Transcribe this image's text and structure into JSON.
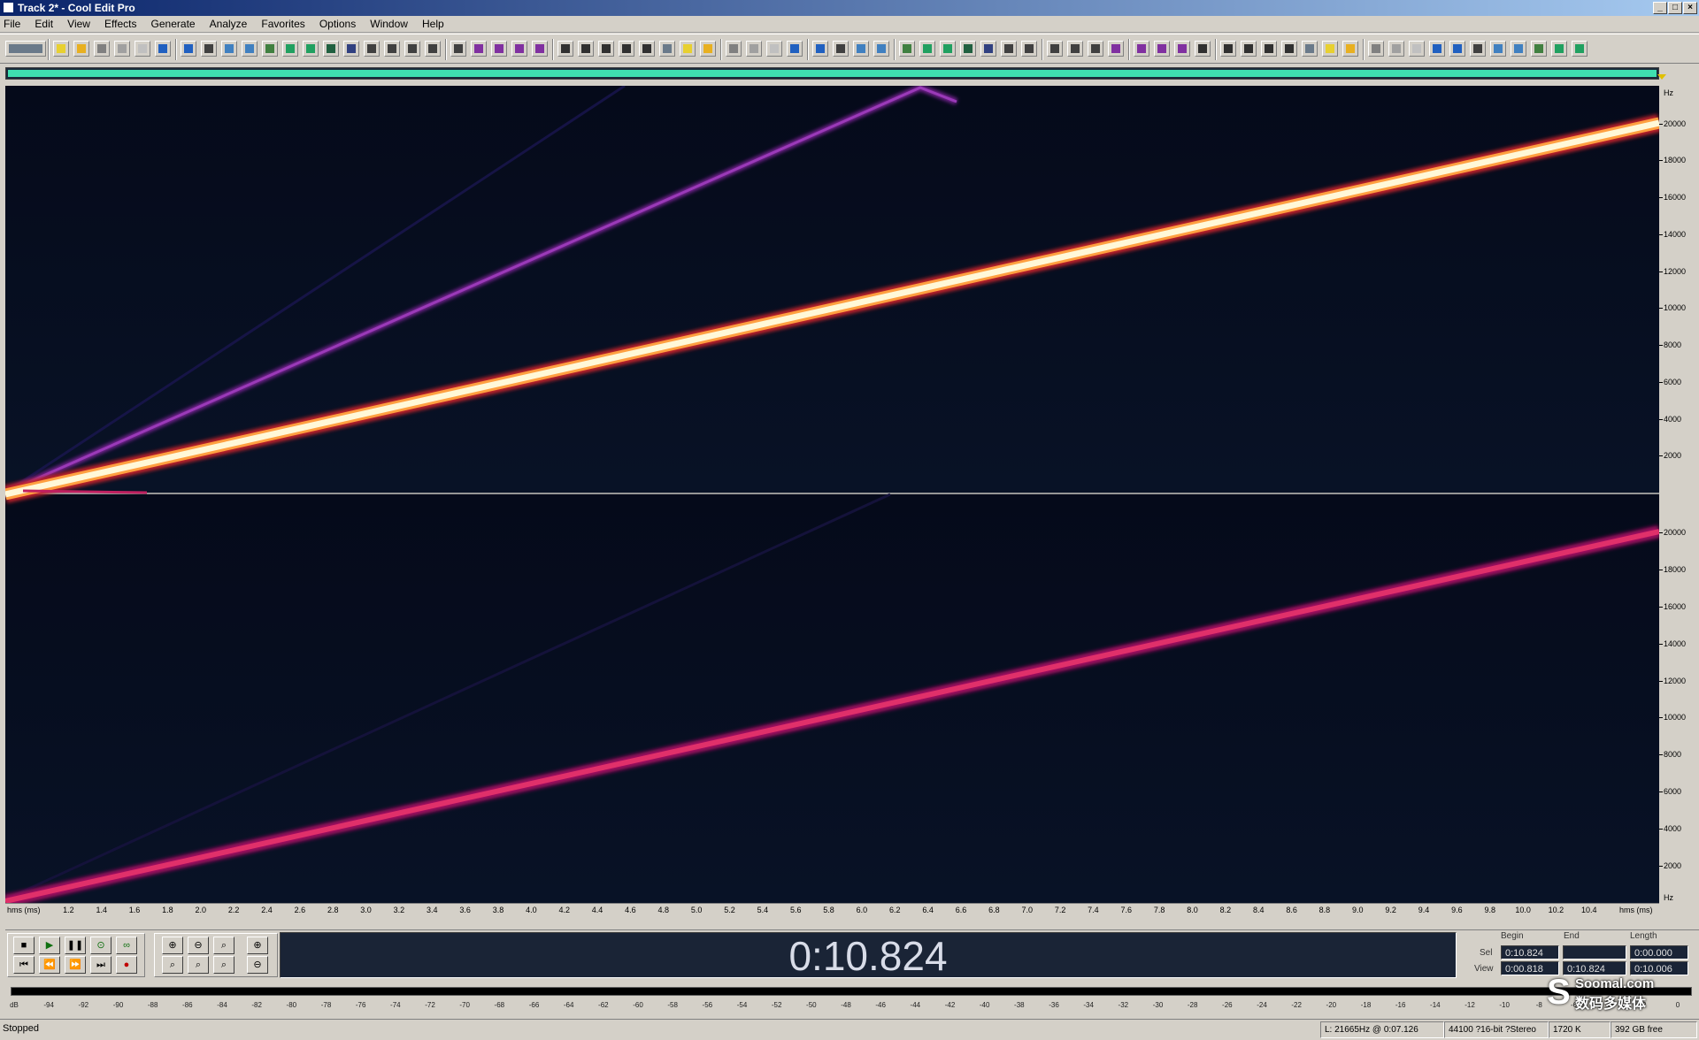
{
  "window": {
    "title": "Track 2* - Cool Edit Pro",
    "controls": [
      "_",
      "□",
      "×"
    ]
  },
  "menu": [
    "File",
    "Edit",
    "View",
    "Effects",
    "Generate",
    "Analyze",
    "Favorites",
    "Options",
    "Window",
    "Help"
  ],
  "spectrogram": {
    "view": "spectral-view",
    "channels": [
      "left",
      "right"
    ],
    "freq_unit": "Hz",
    "freq_labels": [
      "20000",
      "18000",
      "16000",
      "14000",
      "12000",
      "10000",
      "8000",
      "6000",
      "4000",
      "2000"
    ],
    "time_unit_left": "hms (ms)",
    "time_unit_right": "hms (ms)",
    "time_labels": [
      "1.2",
      "1.4",
      "1.6",
      "1.8",
      "2.0",
      "2.2",
      "2.4",
      "2.6",
      "2.8",
      "3.0",
      "3.2",
      "3.4",
      "3.6",
      "3.8",
      "4.0",
      "4.2",
      "4.4",
      "4.6",
      "4.8",
      "5.0",
      "5.2",
      "5.4",
      "5.6",
      "5.8",
      "6.0",
      "6.2",
      "6.4",
      "6.6",
      "6.8",
      "7.0",
      "7.2",
      "7.4",
      "7.6",
      "7.8",
      "8.0",
      "8.2",
      "8.4",
      "8.6",
      "8.8",
      "9.0",
      "9.2",
      "9.4",
      "9.6",
      "9.8",
      "10.0",
      "10.2",
      "10.4"
    ],
    "colors": {
      "background": "#060b1c",
      "main_sweep": "#fff4c8",
      "alias_sweep": "#8a2aa0",
      "right_sweep": "#e0306a"
    }
  },
  "transport": {
    "time_display": "0:10.824"
  },
  "selection": {
    "headers": [
      "Begin",
      "End",
      "Length"
    ],
    "rows": [
      {
        "label": "Sel",
        "begin": "0:10.824",
        "end": "",
        "length": "0:00.000"
      },
      {
        "label": "View",
        "begin": "0:00.818",
        "end": "0:10.824",
        "length": "0:10.006"
      }
    ]
  },
  "meter": {
    "labels": [
      "dB",
      "-94",
      "-92",
      "-90",
      "-88",
      "-86",
      "-84",
      "-82",
      "-80",
      "-78",
      "-76",
      "-74",
      "-72",
      "-70",
      "-68",
      "-66",
      "-64",
      "-62",
      "-60",
      "-58",
      "-56",
      "-54",
      "-52",
      "-50",
      "-48",
      "-46",
      "-44",
      "-42",
      "-40",
      "-38",
      "-36",
      "-34",
      "-32",
      "-30",
      "-28",
      "-26",
      "-24",
      "-22",
      "-20",
      "-18",
      "-16",
      "-14",
      "-12",
      "-10",
      "-8",
      "-6",
      "-4",
      "-2",
      "0"
    ]
  },
  "watermark": {
    "line1": "Soomal.com",
    "line2": "数码多媒体"
  },
  "status": {
    "state": "Stopped",
    "cursor": "L: 21665Hz @  0:07.126",
    "format": "44100 ?16-bit ?Stereo",
    "size": "1720 K",
    "free": "392 GB free"
  }
}
